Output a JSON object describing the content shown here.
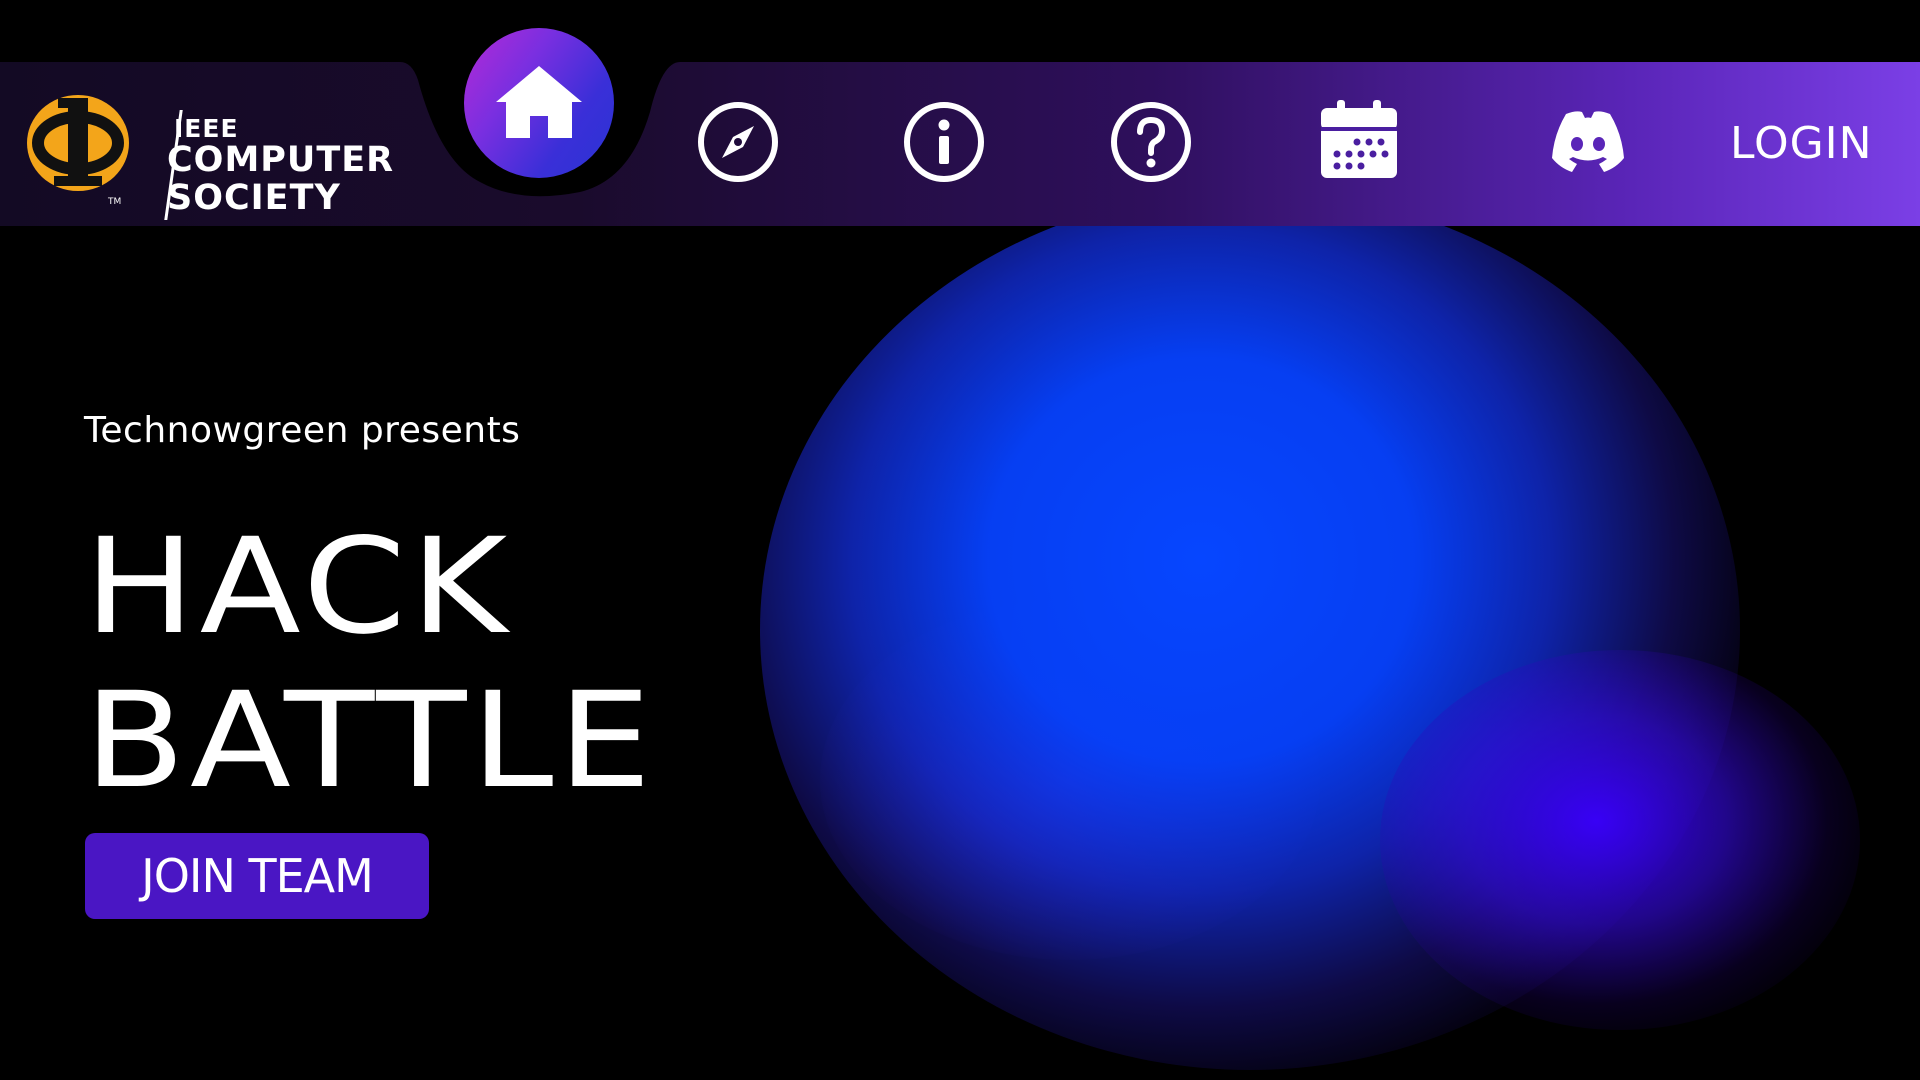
{
  "colors": {
    "background": "#000000",
    "navbar_gradient_start": "#14091f",
    "navbar_gradient_end": "#7a3ce6",
    "accent_button": "#4a16c4",
    "logo_gold": "#f3a51a",
    "glow_blue": "#0646ff",
    "glow_violet": "#3a00ff"
  },
  "navbar": {
    "brand": {
      "line1": "IEEE",
      "line2": "COMPUTER",
      "line3": "SOCIETY",
      "trademark": "TM",
      "logo_icon": "ieee-cs-logo"
    },
    "items": [
      {
        "icon": "home-icon",
        "active": true
      },
      {
        "icon": "compass-icon"
      },
      {
        "icon": "info-icon"
      },
      {
        "icon": "help-icon"
      },
      {
        "icon": "calendar-icon"
      },
      {
        "icon": "discord-icon"
      }
    ],
    "login_label": "LOGIN"
  },
  "hero": {
    "subtitle": "Technowgreen presents",
    "title_line1": "HACK",
    "title_line2": "BATTLE",
    "cta_label": "JOIN TEAM"
  }
}
